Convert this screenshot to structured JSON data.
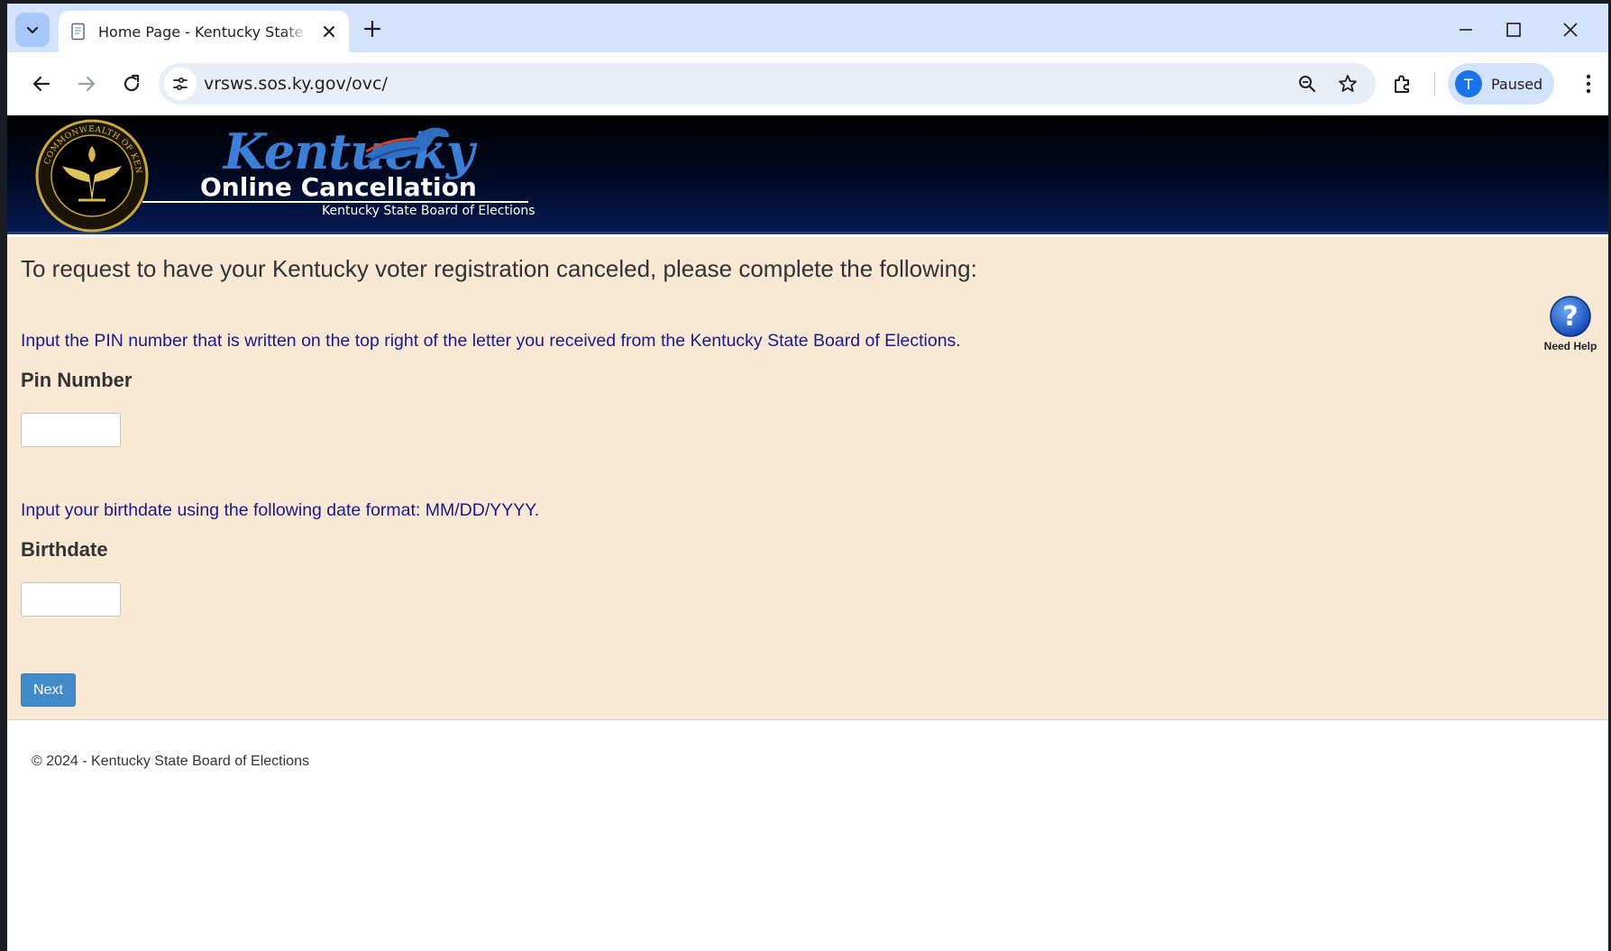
{
  "browser": {
    "tab_title": "Home Page - Kentucky State Board of Elections",
    "url": "vrsws.sos.ky.gov/ovc/",
    "profile_initial": "T",
    "profile_status": "Paused"
  },
  "banner": {
    "logo_word": "Kentucky",
    "title": "Online Cancellation",
    "tagline": "Kentucky State Board of Elections",
    "seal_text": "COMMONWEALTH OF KENTUCKY · OFFICE OF SECRETARY OF STATE"
  },
  "form": {
    "intro": "To request to have your Kentucky voter registration canceled, please complete the following:",
    "pin_instruction": "Input the PIN number that is written on the top right of the letter you received from the Kentucky State Board of Elections.",
    "pin_label": "Pin Number",
    "pin_value": "",
    "birthdate_instruction": "Input your birthdate using the following date format: MM/DD/YYYY.",
    "birthdate_label": "Birthdate",
    "birthdate_value": "",
    "next_label": "Next"
  },
  "help": {
    "label": "Need Help"
  },
  "footer": {
    "text": "© 2024 - Kentucky State Board of Elections"
  },
  "colors": {
    "form_background": "#f8e8d4",
    "instruction_text": "#1a1a8c",
    "button": "#428bca",
    "banner": "#000a24"
  }
}
